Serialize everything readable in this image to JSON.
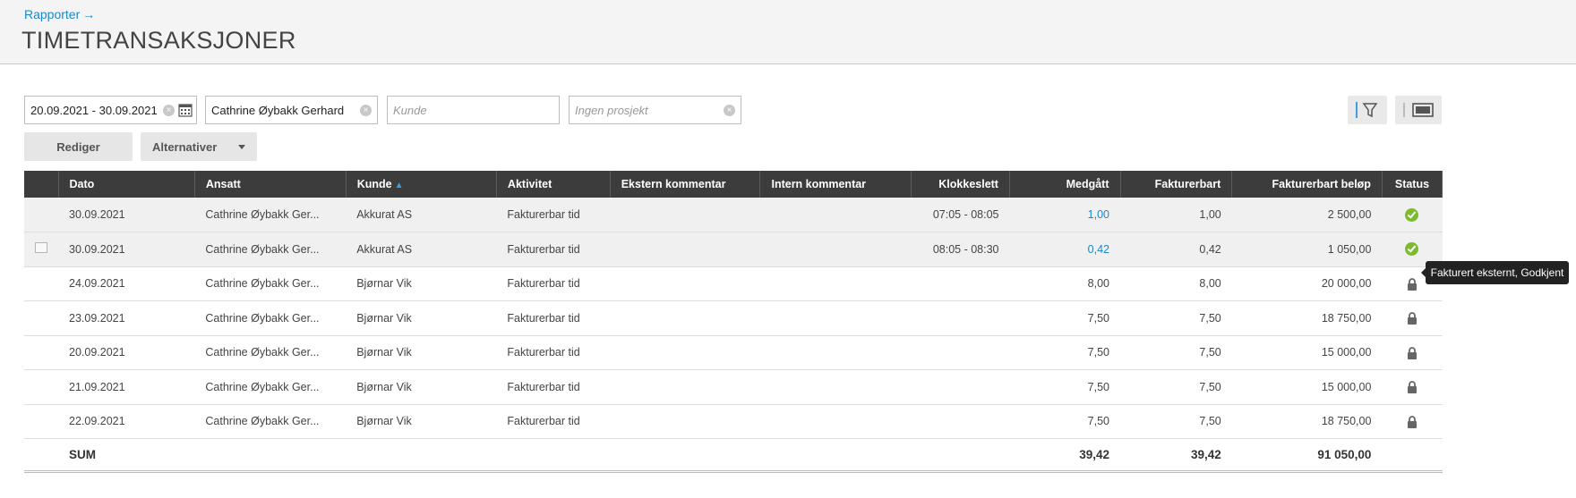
{
  "header": {
    "breadcrumb": "Rapporter",
    "breadcrumb_arrow": "→",
    "title": "TIMETRANSAKSJONER"
  },
  "filters": {
    "date_range": "20.09.2021 - 30.09.2021",
    "employee": "Cathrine Øybakk Gerhard",
    "customer_placeholder": "Kunde",
    "project": "Ingen prosjekt"
  },
  "toolbar": {
    "edit_label": "Rediger",
    "options_label": "Alternativer"
  },
  "table": {
    "columns": [
      "Dato",
      "Ansatt",
      "Kunde",
      "Aktivitet",
      "Ekstern kommentar",
      "Intern kommentar",
      "Klokkeslett",
      "Medgått",
      "Fakturerbart",
      "Fakturerbart beløp",
      "Status"
    ],
    "rows": [
      {
        "date": "30.09.2021",
        "employee": "Cathrine Øybakk Ger...",
        "customer": "Akkurat AS",
        "activity": "Fakturerbar tid",
        "ext": "",
        "int": "",
        "time": "07:05 - 08:05",
        "spent": "1,00",
        "billable": "1,00",
        "amount": "2 500,00",
        "status": "approved"
      },
      {
        "date": "30.09.2021",
        "employee": "Cathrine Øybakk Ger...",
        "customer": "Akkurat AS",
        "activity": "Fakturerbar tid",
        "ext": "",
        "int": "",
        "time": "08:05 - 08:30",
        "spent": "0,42",
        "billable": "0,42",
        "amount": "1 050,00",
        "status": "approved"
      },
      {
        "date": "24.09.2021",
        "employee": "Cathrine Øybakk Ger...",
        "customer": "Bjørnar Vik",
        "activity": "Fakturerbar tid",
        "ext": "",
        "int": "",
        "time": "",
        "spent": "8,00",
        "billable": "8,00",
        "amount": "20 000,00",
        "status": "locked"
      },
      {
        "date": "23.09.2021",
        "employee": "Cathrine Øybakk Ger...",
        "customer": "Bjørnar Vik",
        "activity": "Fakturerbar tid",
        "ext": "",
        "int": "",
        "time": "",
        "spent": "7,50",
        "billable": "7,50",
        "amount": "18 750,00",
        "status": "locked"
      },
      {
        "date": "20.09.2021",
        "employee": "Cathrine Øybakk Ger...",
        "customer": "Bjørnar Vik",
        "activity": "Fakturerbar tid",
        "ext": "",
        "int": "",
        "time": "",
        "spent": "7,50",
        "billable": "7,50",
        "amount": "15 000,00",
        "status": "locked"
      },
      {
        "date": "21.09.2021",
        "employee": "Cathrine Øybakk Ger...",
        "customer": "Bjørnar Vik",
        "activity": "Fakturerbar tid",
        "ext": "",
        "int": "",
        "time": "",
        "spent": "7,50",
        "billable": "7,50",
        "amount": "15 000,00",
        "status": "locked"
      },
      {
        "date": "22.09.2021",
        "employee": "Cathrine Øybakk Ger...",
        "customer": "Bjørnar Vik",
        "activity": "Fakturerbar tid",
        "ext": "",
        "int": "",
        "time": "",
        "spent": "7,50",
        "billable": "7,50",
        "amount": "18 750,00",
        "status": "locked"
      }
    ],
    "sum": {
      "label": "SUM",
      "spent": "39,42",
      "billable": "39,42",
      "amount": "91 050,00"
    }
  },
  "tooltip": "Fakturert eksternt, Godkjent",
  "colors": {
    "accent": "#1a88c9",
    "header_bg": "#3c3c3c",
    "approved": "#7cbb2f"
  }
}
